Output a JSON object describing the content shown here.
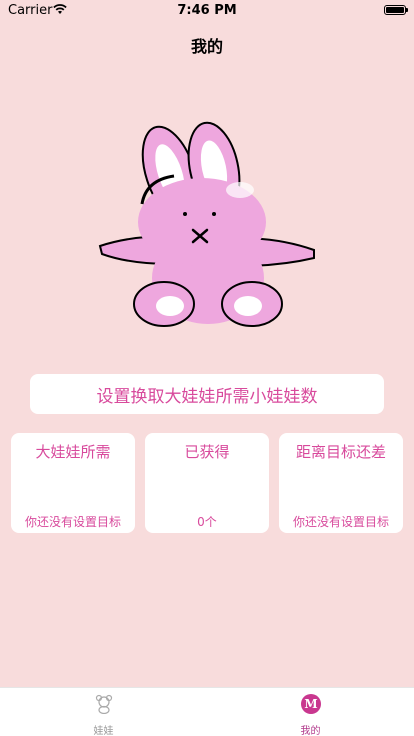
{
  "status_bar": {
    "carrier": "Carrier",
    "time": "7:46 PM"
  },
  "header": {
    "title": "我的"
  },
  "main": {
    "set_target_label": "设置换取大娃娃所需小娃娃数",
    "cards": [
      {
        "title": "大娃娃所需",
        "value": "你还没有设置目标"
      },
      {
        "title": "已获得",
        "value": "0个"
      },
      {
        "title": "距离目标还差",
        "value": "你还没有设置目标"
      }
    ]
  },
  "tab_bar": {
    "tabs": [
      {
        "label": "娃娃",
        "icon": "bear-icon",
        "active": false
      },
      {
        "label": "我的",
        "icon": "m-badge-icon",
        "badge_letter": "M",
        "active": true
      }
    ]
  },
  "colors": {
    "background": "#f8dcdc",
    "accent": "#d84a9c",
    "bunny_pink": "#eea7de"
  }
}
